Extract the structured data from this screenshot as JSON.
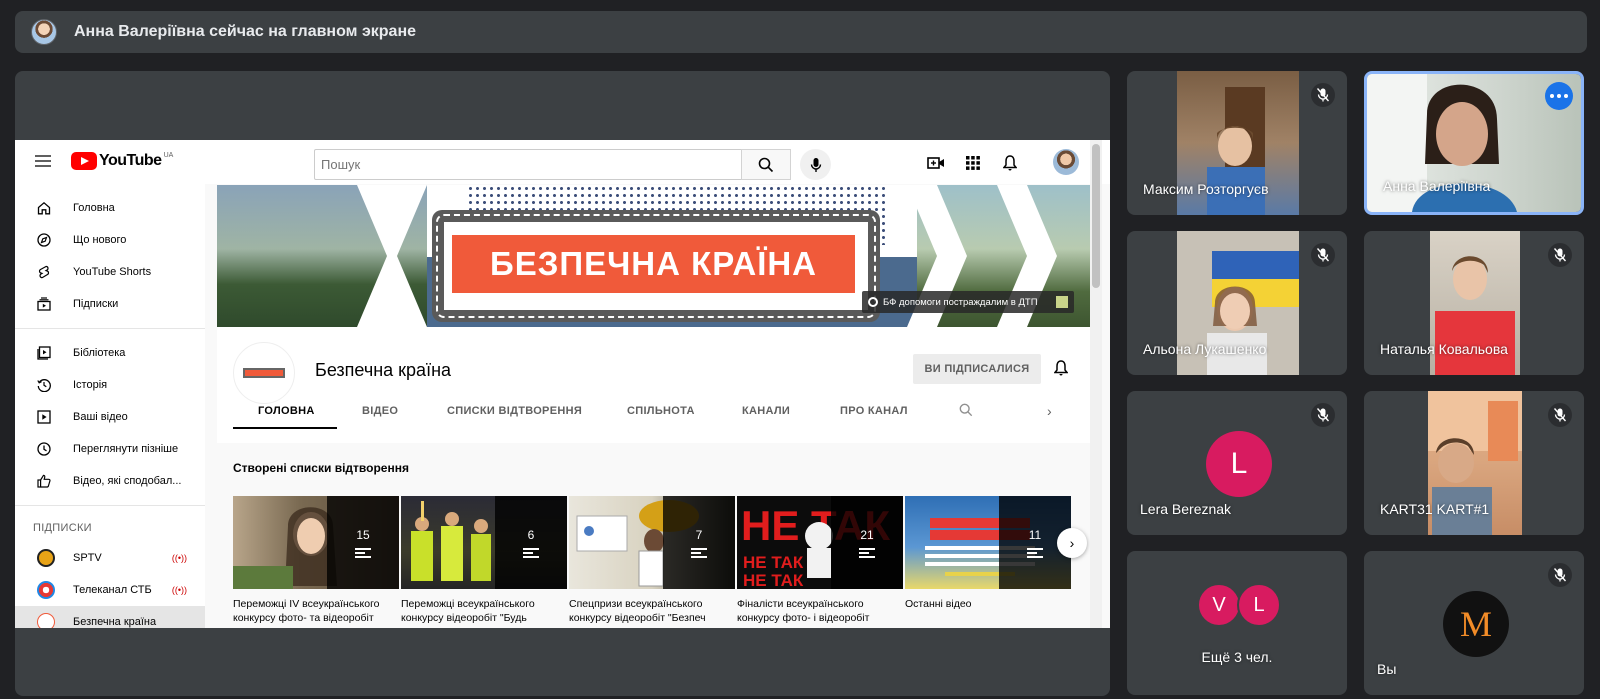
{
  "presenter_banner": {
    "text": "Анна Валеріївна сейчас на главном экране"
  },
  "youtube": {
    "logo_text": "YouTube",
    "region": "UA",
    "search_placeholder": "Пошук",
    "sidebar": {
      "main": [
        {
          "label": "Головна",
          "icon": "home-icon"
        },
        {
          "label": "Що нового",
          "icon": "explore-icon"
        },
        {
          "label": "YouTube Shorts",
          "icon": "shorts-icon"
        },
        {
          "label": "Підписки",
          "icon": "subscriptions-icon"
        }
      ],
      "library": [
        {
          "label": "Бібліотека",
          "icon": "library-icon"
        },
        {
          "label": "Історія",
          "icon": "history-icon"
        },
        {
          "label": "Ваші відео",
          "icon": "your-videos-icon"
        },
        {
          "label": "Переглянути пізніше",
          "icon": "watch-later-icon"
        },
        {
          "label": "Відео, які сподобал...",
          "icon": "thumbs-up-icon"
        }
      ],
      "subscriptions_header": "ПІДПИСКИ",
      "subscriptions": [
        {
          "label": "SPTV",
          "color": "#e8a317",
          "live": true
        },
        {
          "label": "Телеканал СТБ",
          "color": "#e53935",
          "live": true
        },
        {
          "label": "Безпечна країна",
          "color": "#f05a3a",
          "live": false
        }
      ]
    },
    "channel": {
      "banner_title": "БЕЗПЕЧНА КРАЇНА",
      "banner_caption": "БФ допомоги постраждалим в ДТП",
      "name": "Безпечна країна",
      "subscribed_label": "ВИ ПІДПИСАЛИСЯ",
      "tabs": [
        "ГОЛОВНА",
        "ВІДЕО",
        "СПИСКИ ВІДТВОРЕННЯ",
        "СПІЛЬНОТА",
        "КАНАЛИ",
        "ПРО КАНАЛ"
      ],
      "active_tab": "ГОЛОВНА"
    },
    "playlists_section": {
      "title": "Створені списки відтворення",
      "items": [
        {
          "title": "Переможці IV всеукраїнського конкурсу фото- та відеоробіт",
          "count": "15"
        },
        {
          "title": "Переможці всеукраїнського конкурсу відеоробіт \"Будь",
          "count": "6"
        },
        {
          "title": "Спецпризи всеукраїнського конкурсу відеоробіт \"Безпеч",
          "count": "7"
        },
        {
          "title": "Фіналісти всеукраїнського конкурсу фото- і відеоробіт",
          "count": "21"
        },
        {
          "title": "Останні відео",
          "count": "11"
        }
      ]
    }
  },
  "participants": [
    {
      "name": "Максим Розторгуєв",
      "muted": true
    },
    {
      "name": "Анна Валеріївна",
      "muted": false,
      "speaking": true
    },
    {
      "name": "Альона Лукашенко",
      "muted": true
    },
    {
      "name": "Наталья Ковальова",
      "muted": true
    },
    {
      "name": "Lera Bereznak",
      "muted": true,
      "initial": "L",
      "avatar_color": "#d81b60"
    },
    {
      "name": "KART31 KART#1",
      "muted": true
    },
    {
      "name": "Ещё 3 чел.",
      "initials": [
        "V",
        "L"
      ],
      "avatar_color": "#d81b60"
    },
    {
      "name": "Вы",
      "muted": true,
      "initial": "M"
    }
  ]
}
